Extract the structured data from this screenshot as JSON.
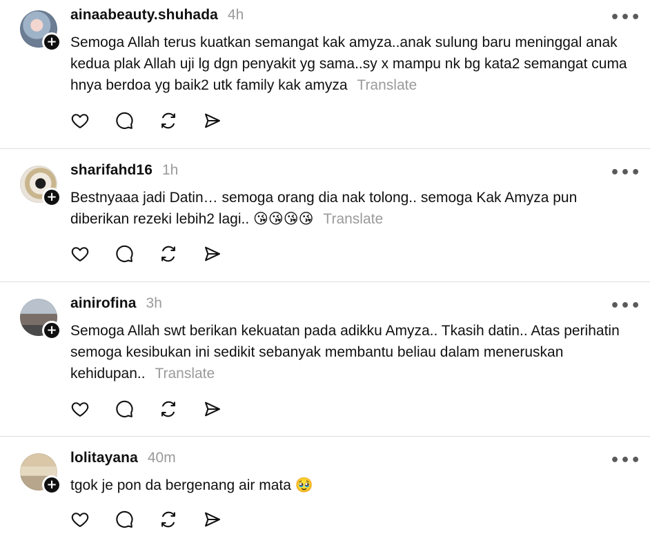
{
  "translate_label": "Translate",
  "more_label": "•••",
  "follow_badge": "+",
  "posts": [
    {
      "username": "ainaabeauty.shuhada",
      "time": "4h",
      "text": "Semoga Allah terus kuatkan semangat kak amyza..anak sulung baru meninggal anak kedua plak Allah uji lg dgn penyakit yg sama..sy x mampu nk bg kata2 semangat cuma hnya berdoa yg baik2 utk family kak amyza"
    },
    {
      "username": "sharifahd16",
      "time": "1h",
      "text": "Bestnyaaa jadi Datin… semoga orang dia nak tolong.. semoga Kak Amyza pun diberikan rezeki lebih2 lagi.. 😘😘😘😘"
    },
    {
      "username": "ainirofina",
      "time": "3h",
      "text": "Semoga Allah swt berikan kekuatan pada adikku Amyza.. Tkasih datin.. Atas perihatin semoga kesibukan ini sedikit sebanyak membantu beliau dalam meneruskan kehidupan.."
    },
    {
      "username": "lolitayana",
      "time": "40m",
      "text": "tgok je pon da bergenang air mata 🥹"
    }
  ],
  "actions": [
    "heart-icon",
    "comment-icon",
    "repost-icon",
    "send-icon"
  ]
}
